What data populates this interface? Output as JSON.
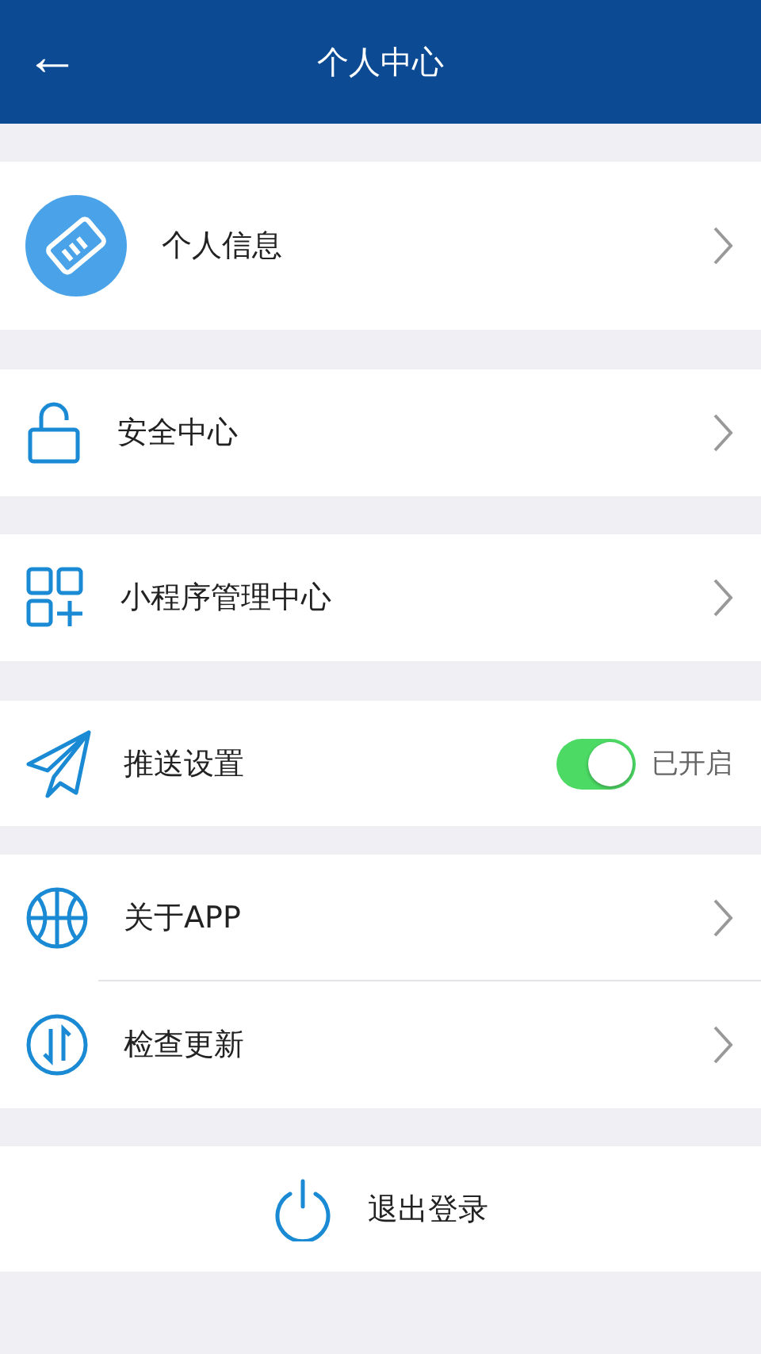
{
  "header": {
    "back": "←",
    "title": "个人中心"
  },
  "groups": [
    {
      "items": [
        {
          "kind": "profile",
          "label": "个人信息"
        }
      ]
    },
    {
      "items": [
        {
          "kind": "link",
          "label": "安全中心"
        }
      ]
    },
    {
      "items": [
        {
          "kind": "link",
          "label": "小程序管理中心"
        }
      ]
    },
    {
      "items": [
        {
          "kind": "toggle",
          "label": "推送设置",
          "on": true,
          "status": "已开启"
        }
      ]
    },
    {
      "items": [
        {
          "kind": "link",
          "label": "关于APP"
        },
        {
          "kind": "link",
          "label": "检查更新"
        }
      ]
    }
  ],
  "logout": {
    "label": "退出登录"
  }
}
